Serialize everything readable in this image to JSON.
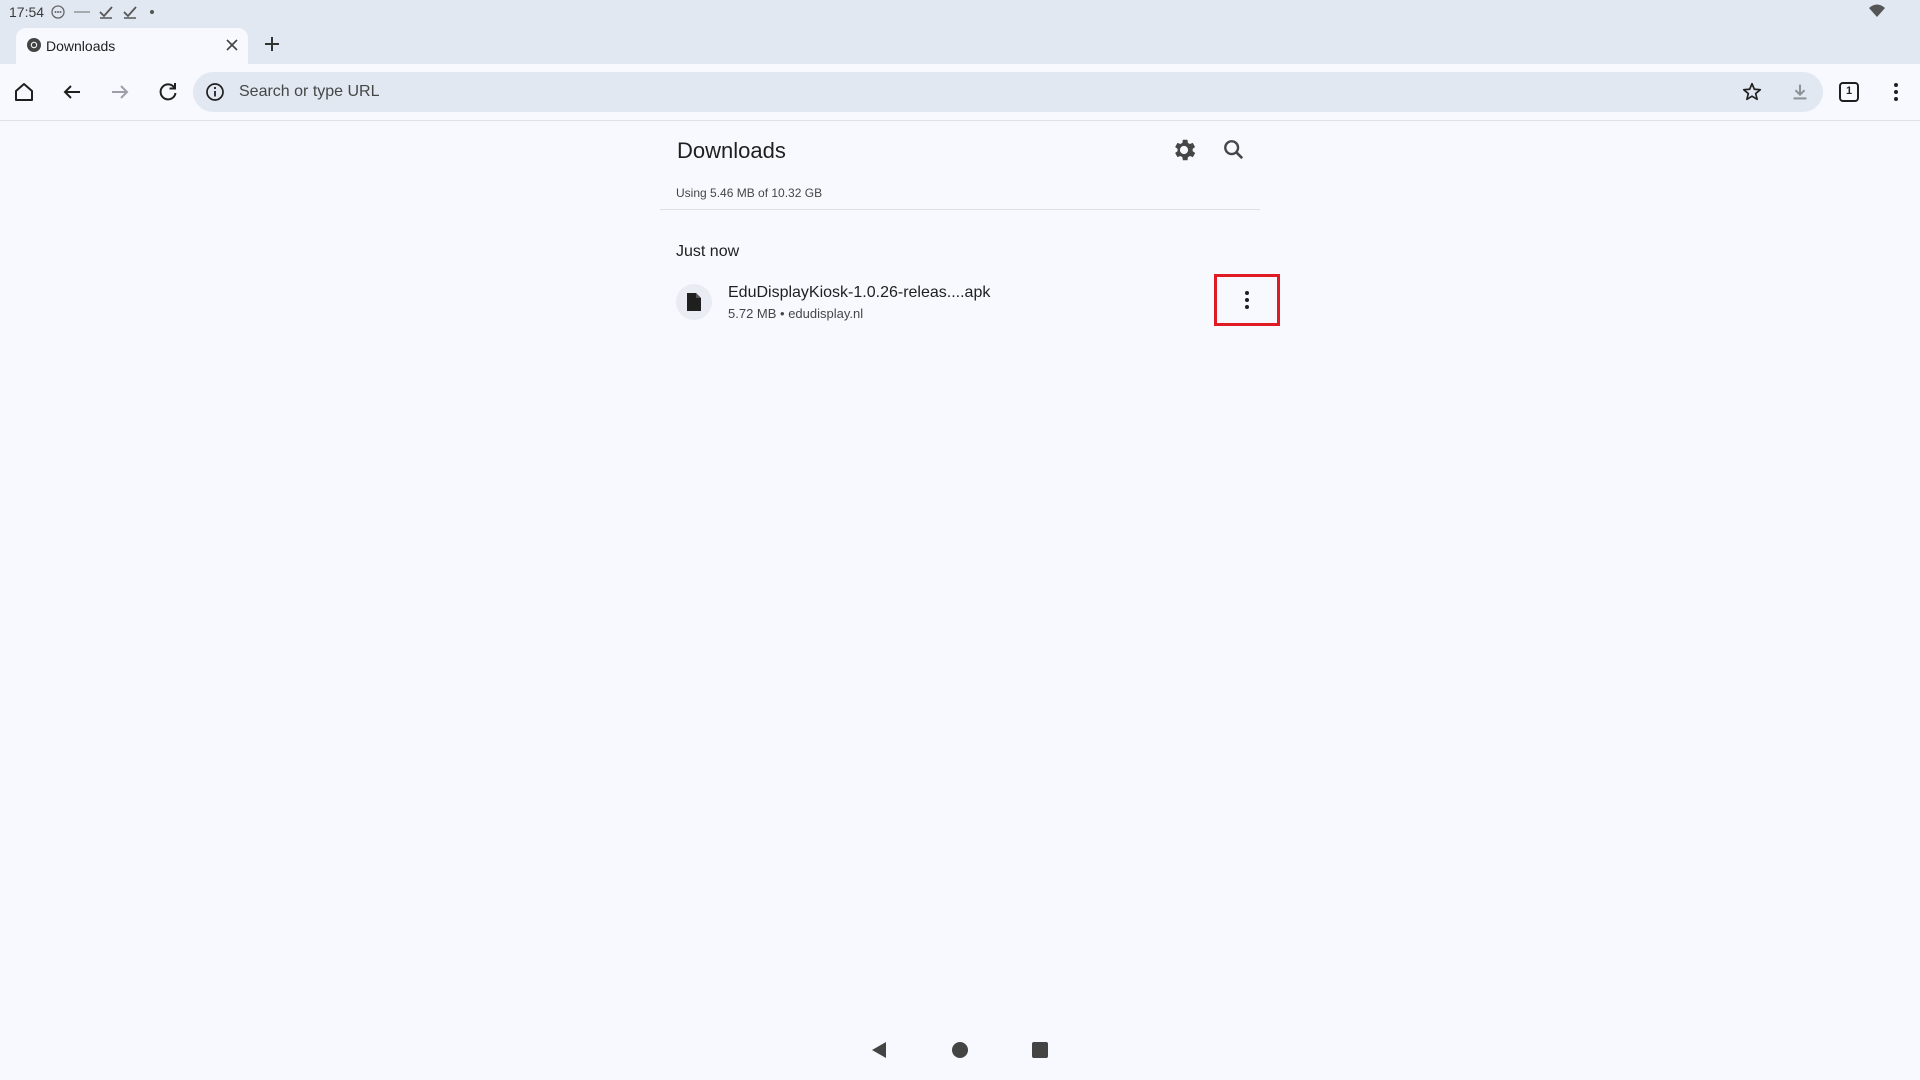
{
  "status_bar": {
    "time": "17:54"
  },
  "tab_strip": {
    "active_tab": {
      "title": "Downloads"
    }
  },
  "toolbar": {
    "omnibox_placeholder": "Search or type URL",
    "tab_count": "1"
  },
  "downloads": {
    "title": "Downloads",
    "storage": "Using 5.46 MB of 10.32 GB",
    "section": "Just now",
    "items": [
      {
        "name": "EduDisplayKiosk-1.0.26-releas....apk",
        "meta": "5.72 MB • edudisplay.nl"
      }
    ]
  },
  "colors": {
    "background": "#f8f9fe",
    "chrome": "#e2e8f2",
    "highlight": "#e01b24"
  }
}
